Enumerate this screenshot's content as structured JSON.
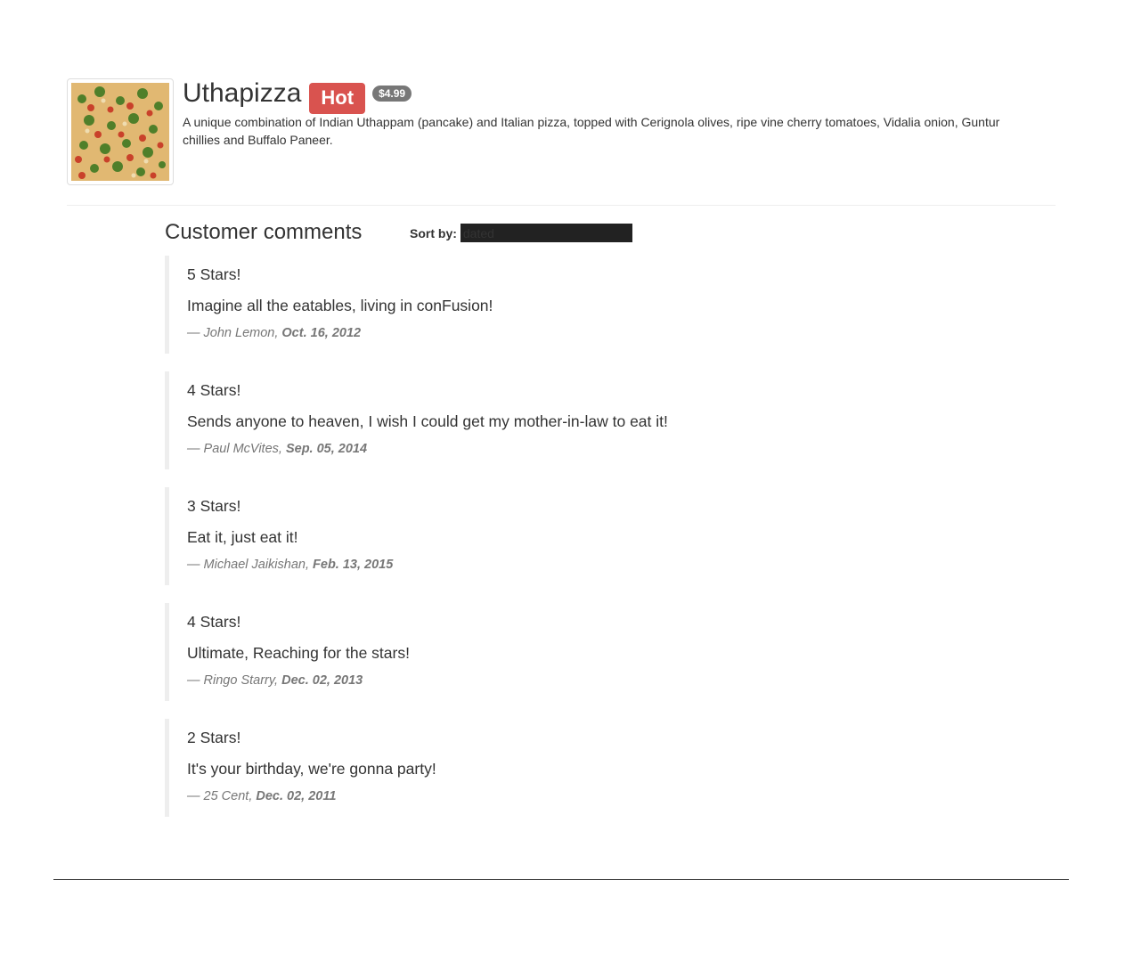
{
  "dish": {
    "name": "Uthapizza",
    "label": "Hot",
    "price": "$4.99",
    "description": "A unique combination of Indian Uthappam (pancake) and Italian pizza, topped with Cerignola olives, ripe vine cherry tomatoes, Vidalia onion, Guntur chillies and Buffalo Paneer.",
    "image_alt": "Uthapizza"
  },
  "comments_section": {
    "title": "Customer comments",
    "sort_label": "Sort by:",
    "sort_value": "dated"
  },
  "comments": [
    {
      "rating": "5 Stars!",
      "text": "Imagine all the eatables, living in conFusion!",
      "author": "— John Lemon,",
      "date": "Oct. 16, 2012"
    },
    {
      "rating": "4 Stars!",
      "text": "Sends anyone to heaven, I wish I could get my mother-in-law to eat it!",
      "author": "— Paul McVites,",
      "date": "Sep. 05, 2014"
    },
    {
      "rating": "3 Stars!",
      "text": "Eat it, just eat it!",
      "author": "— Michael Jaikishan,",
      "date": "Feb. 13, 2015"
    },
    {
      "rating": "4 Stars!",
      "text": "Ultimate, Reaching for the stars!",
      "author": "— Ringo Starry,",
      "date": "Dec. 02, 2013"
    },
    {
      "rating": "2 Stars!",
      "text": "It's your birthday, we're gonna party!",
      "author": "— 25 Cent,",
      "date": "Dec. 02, 2011"
    }
  ],
  "colors": {
    "hot_badge": "#d9534f",
    "price_badge": "#777777",
    "text": "#333333",
    "muted": "#777777",
    "blockquote_border": "#eeeeee"
  }
}
